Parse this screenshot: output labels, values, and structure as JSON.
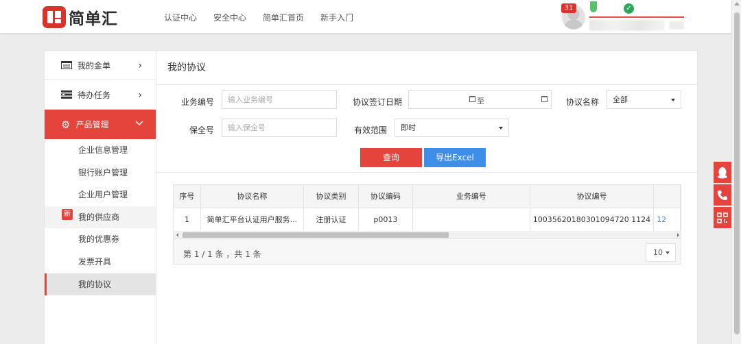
{
  "header": {
    "brand": "简单汇",
    "nav": [
      "认证中心",
      "安全中心",
      "简单汇首页",
      "新手入门"
    ],
    "notification_count": "31"
  },
  "sidebar": {
    "top_items": [
      {
        "label": "我的金单",
        "icon": "document-list-icon"
      },
      {
        "label": "待办任务",
        "icon": "task-icon"
      }
    ],
    "active_section": {
      "label": "产品管理",
      "icon": "gear-icon"
    },
    "sub_items": [
      {
        "label": "企业信息管理"
      },
      {
        "label": "银行账户管理"
      },
      {
        "label": "企业用户管理"
      },
      {
        "label": "我的供应商",
        "tag": "新"
      },
      {
        "label": "我的优惠券"
      },
      {
        "label": "发票开具"
      },
      {
        "label": "我的协议"
      }
    ]
  },
  "page": {
    "title": "我的协议"
  },
  "filters": {
    "business_no_label": "业务编号",
    "business_no_placeholder": "输入业务编号",
    "sign_date_label": "协议签订日期",
    "date_separator": "至",
    "agreement_name_label": "协议名称",
    "agreement_name_value": "全部",
    "policy_no_label": "保全号",
    "policy_no_placeholder": "输入保全号",
    "scope_label": "有效范围",
    "scope_value": "即时",
    "query_button": "查询",
    "export_button": "导出Excel"
  },
  "table": {
    "columns": [
      "序号",
      "协议名称",
      "协议类别",
      "协议编码",
      "业务编号",
      "协议编号"
    ],
    "rows": [
      {
        "index": "1",
        "name": "简单汇平台认证用户服务...",
        "category": "注册认证",
        "code": "p0013",
        "business_no": "",
        "agreement_no": "10035620180301094720 1124",
        "overflow": "12"
      }
    ],
    "pager_text": "第 1 / 1 条 ，共 1 条",
    "page_size": "10"
  },
  "colors": {
    "accent_red": "#e5443c",
    "accent_blue": "#3e8de9"
  }
}
